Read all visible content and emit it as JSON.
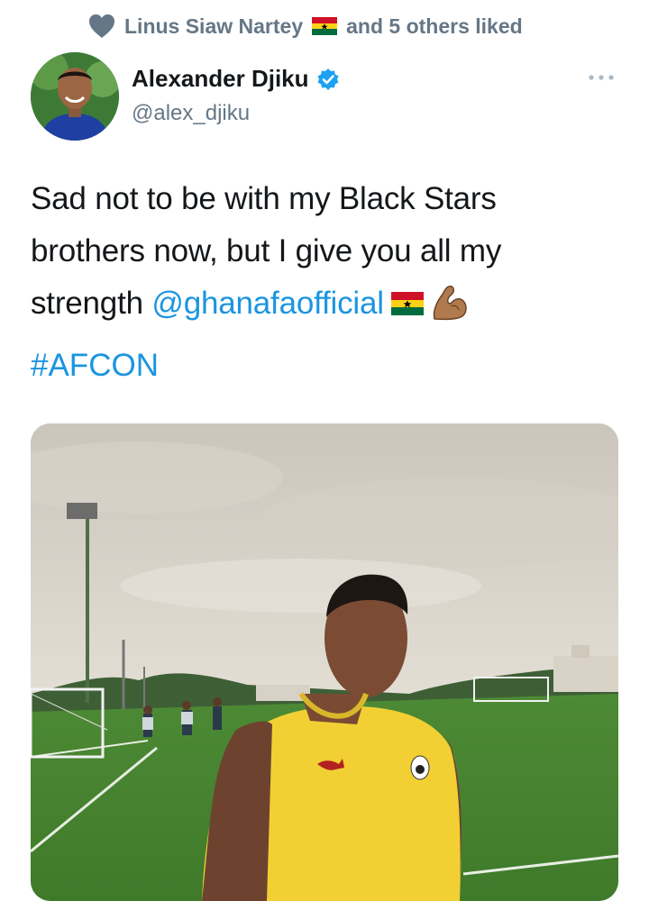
{
  "social_context": {
    "icon": "heart-icon",
    "liker_name": "Linus Siaw Nartey",
    "liker_flag": "ghana-flag-icon",
    "suffix": "and 5 others liked"
  },
  "author": {
    "name": "Alexander Djiku",
    "handle": "@alex_djiku",
    "verified": true,
    "verified_color": "#1da1f2"
  },
  "tweet": {
    "text_line1": "Sad not to be with my Black Stars",
    "text_line2": "brothers now, but I give you all my",
    "text_line3_prefix": "strength ",
    "mention": "@ghanafaofficial",
    "hashtag": "#AFCON",
    "emojis": [
      "ghana-flag-icon",
      "flexed-biceps-icon"
    ]
  },
  "media": {
    "type": "photo",
    "subject": "player in yellow training shirt on football pitch"
  },
  "colors": {
    "link": "#1b95e0",
    "secondary_text": "#657786",
    "primary_text": "#14171a"
  }
}
